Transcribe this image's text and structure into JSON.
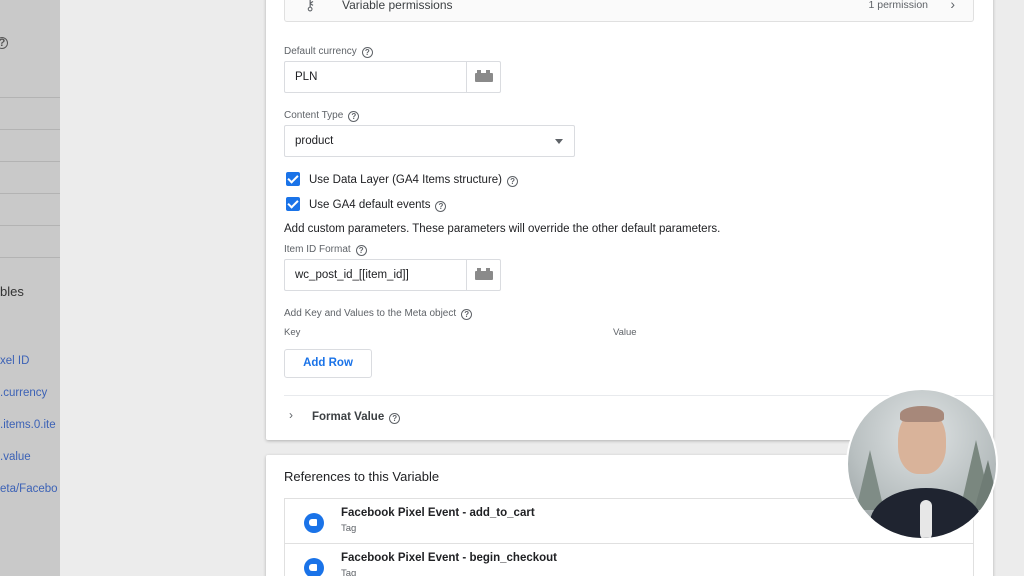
{
  "left_pane": {
    "section_label": "bles",
    "links": [
      "xel ID",
      ".currency",
      ".items.0.ite",
      ".value",
      "eta/Facebo"
    ]
  },
  "permissions": {
    "label": "Variable permissions",
    "count": "1 permission"
  },
  "default_currency": {
    "label": "Default currency",
    "value": "PLN"
  },
  "content_type": {
    "label": "Content Type",
    "value": "product"
  },
  "checkboxes": [
    {
      "label": "Use Data Layer (GA4 Items structure)",
      "checked": true
    },
    {
      "label": "Use GA4 default events",
      "checked": true
    }
  ],
  "custom_params_note": "Add custom parameters. These parameters will override the other default parameters.",
  "item_id_format": {
    "label": "Item ID Format",
    "value": "wc_post_id_[[item_id]]"
  },
  "meta_object": {
    "label": "Add Key and Values to the Meta object",
    "key_header": "Key",
    "value_header": "Value",
    "add_row_label": "Add Row"
  },
  "format_value": {
    "label": "Format Value"
  },
  "references": {
    "title": "References to this Variable",
    "items": [
      {
        "name": "Facebook Pixel Event - add_to_cart",
        "type": "Tag"
      },
      {
        "name": "Facebook Pixel Event - begin_checkout",
        "type": "Tag"
      }
    ]
  },
  "colors": {
    "accent": "#1a73e8",
    "link": "#3c62b6",
    "border": "#dadce0"
  }
}
